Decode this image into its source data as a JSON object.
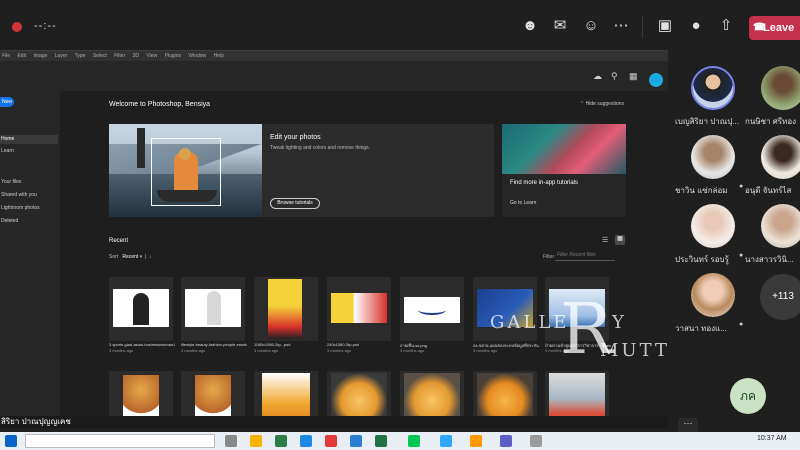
{
  "teams": {
    "timer": "--:--",
    "leave_label": "Leave"
  },
  "photoshop": {
    "menu": [
      "File",
      "Edit",
      "Image",
      "Layer",
      "Type",
      "Select",
      "Filter",
      "3D",
      "View",
      "Plugins",
      "Window",
      "Help"
    ],
    "new_label": "New",
    "sidebar_items": [
      "Home",
      "Learn",
      "Your files",
      "Shared with you",
      "Lightroom photos",
      "Deleted"
    ],
    "welcome": "Welcome to Photoshop, Bensiya",
    "hide_suggestions": "Hide suggestions",
    "edit_card": {
      "title": "Edit your photos",
      "desc": "Tweak lighting and colors and remove things.",
      "button": "Browse tutorials"
    },
    "tutorial_card": {
      "title": "Find more in-app tutorials",
      "link": "Go to Learn"
    },
    "recent": {
      "title": "Recent",
      "sort_label": "Sort",
      "sort_value": "Recent",
      "filter_label": "Filter",
      "filter_placeholder": "Filter Recent files",
      "files": [
        {
          "name": "3 sports-glad-asian-businesswoman-black-suit-...",
          "date": "3 months ago"
        },
        {
          "name": "lifestyle-beauty-fashion-people-emotions-concept-...",
          "date": "3 months ago"
        },
        {
          "name": "1080x1080-2tp...psd",
          "date": "3 months ago"
        },
        {
          "name": "240x1080-3tp.psd",
          "date": "3 months ago"
        },
        {
          "name": "ลายเซ็น-ss.png",
          "date": "3 months ago"
        },
        {
          "name": "04-ขยาย-แผนของระบบข้อมูลที่ประกันสินค้าฯ.png",
          "date": "3 months ago"
        },
        {
          "name": "ป้ายทางเข้าศูนย์บริการวิชาการ Create.jpg",
          "date": "3 months ago"
        }
      ]
    }
  },
  "participants": [
    {
      "name": "เบญสิริยา ปาณปุ...",
      "selected": true
    },
    {
      "name": "กนษิชา ศรีทอง"
    },
    {
      "name": "ชาวิน แซ่กล่อม"
    },
    {
      "name": "อนุดี จันทร์ไส"
    },
    {
      "name": "ประวินทร์ รอบรู้"
    },
    {
      "name": "นางสาวรวินิ..."
    },
    {
      "name": "วาสนา ทองแ..."
    }
  ],
  "more_count": "+113",
  "self_initials": "ภค",
  "presenter_caption": "สิริยา ปาณปุญญเคช",
  "watermark": {
    "line1": "GALLE",
    "big": "R",
    "suffix": "Y",
    "line2": "MUTT"
  },
  "taskbar": {
    "clock": "10:37 AM"
  }
}
